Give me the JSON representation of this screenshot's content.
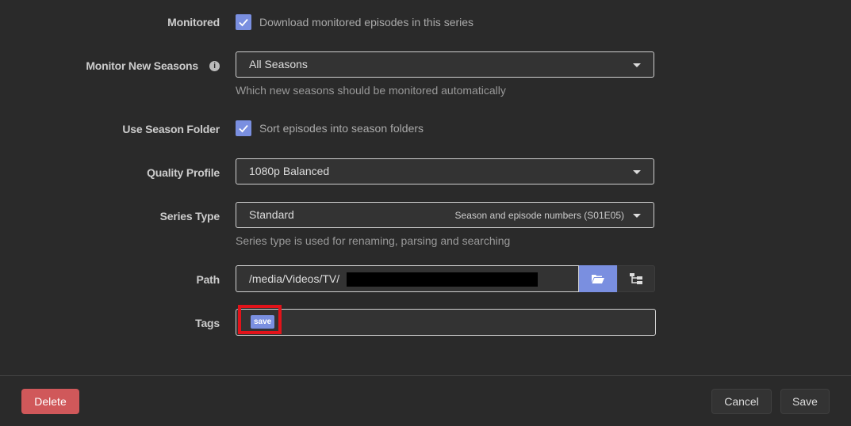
{
  "form": {
    "monitored": {
      "label": "Monitored",
      "checked": true,
      "text": "Download monitored episodes in this series"
    },
    "monitor_new_seasons": {
      "label": "Monitor New Seasons",
      "info_icon": "info-icon",
      "value": "All Seasons",
      "help": "Which new seasons should be monitored automatically"
    },
    "use_season_folder": {
      "label": "Use Season Folder",
      "checked": true,
      "text": "Sort episodes into season folders"
    },
    "quality_profile": {
      "label": "Quality Profile",
      "value": "1080p Balanced"
    },
    "series_type": {
      "label": "Series Type",
      "value": "Standard",
      "hint": "Season and episode numbers (S01E05)",
      "help": "Series type is used for renaming, parsing and searching"
    },
    "path": {
      "label": "Path",
      "value": "/media/Videos/TV/",
      "folder_icon": "folder-open-icon",
      "tree_icon": "file-tree-icon"
    },
    "tags": {
      "label": "Tags",
      "items": [
        "save"
      ]
    }
  },
  "footer": {
    "delete_label": "Delete",
    "cancel_label": "Cancel",
    "save_label": "Save"
  },
  "colors": {
    "accent": "#7a8fe0",
    "danger": "#d0585a",
    "highlight": "#e2131a",
    "background": "#2a2a2a"
  }
}
